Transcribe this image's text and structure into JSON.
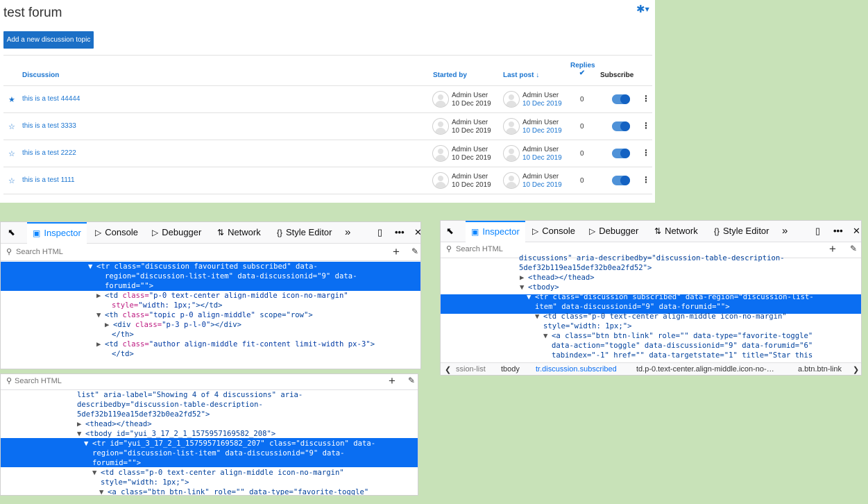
{
  "forum": {
    "title": "test forum",
    "add_button": "Add a new discussion topic",
    "headers": {
      "discussion": "Discussion",
      "started_by": "Started by",
      "last_post": "Last post",
      "replies": "Replies",
      "subscribe": "Subscribe"
    },
    "rows": [
      {
        "topic": "this is a test 44444",
        "starred": true,
        "start_user": "Admin User",
        "start_date": "10 Dec 2019",
        "last_user": "Admin User",
        "last_date": "10 Dec 2019",
        "replies": "0",
        "subscribed": true
      },
      {
        "topic": "this is a test 3333",
        "starred": false,
        "start_user": "Admin User",
        "start_date": "10 Dec 2019",
        "last_user": "Admin User",
        "last_date": "10 Dec 2019",
        "replies": "0",
        "subscribed": true
      },
      {
        "topic": "this is a test 2222",
        "starred": false,
        "start_user": "Admin User",
        "start_date": "10 Dec 2019",
        "last_user": "Admin User",
        "last_date": "10 Dec 2019",
        "replies": "0",
        "subscribed": true
      },
      {
        "topic": "this is a test 1111",
        "starred": false,
        "start_user": "Admin User",
        "start_date": "10 Dec 2019",
        "last_user": "Admin User",
        "last_date": "10 Dec 2019",
        "replies": "0",
        "subscribed": true
      }
    ]
  },
  "devtools": {
    "tabs": {
      "inspector": "Inspector",
      "console": "Console",
      "debugger": "Debugger",
      "network": "Network",
      "style_editor": "Style Editor"
    },
    "search_placeholder": "Search HTML"
  },
  "panel1": {
    "lines": [
      {
        "a": "<tr ",
        "b": "class=",
        "c": "\"discussion favourited subscribed\"",
        "d": " data-"
      },
      {
        "a": "",
        "b": "region=",
        "c": "\"discussion-list-item\"",
        "d": " data-discussionid=\"9\" data-"
      },
      {
        "a": "",
        "b": "forumid=",
        "c": "\"\"",
        "d": ">"
      },
      {
        "a": "<td ",
        "b": "class=",
        "c": "\"p-0 text-center align-middle icon-no-margin\"",
        "d": ""
      },
      {
        "a": "",
        "b": "style=",
        "c": "\"width: 1px;\"",
        "d": "></td>"
      },
      {
        "a": "<th ",
        "b": "class=",
        "c": "\"topic p-0 align-middle\"",
        "d": " scope=\"row\">"
      },
      {
        "a": "<div ",
        "b": "class=",
        "c": "\"p-3 p-l-0\"",
        "d": "></div>"
      },
      {
        "a": "</th>",
        "b": "",
        "c": "",
        "d": ""
      },
      {
        "a": "<td ",
        "b": "class=",
        "c": "\"author align-middle fit-content limit-width px-3\"",
        "d": ">"
      },
      {
        "a": "</td>",
        "b": "",
        "c": "",
        "d": ""
      }
    ]
  },
  "panel2": {
    "lines": [
      {
        "text": "list\" aria-label=\"Showing 4 of 4 discussions\" aria-"
      },
      {
        "text": "describedby=\"discussion-table-description-"
      },
      {
        "text": "5def32b119ea15def32b0ea2fd52\">"
      },
      {
        "text": "<thead></thead>"
      },
      {
        "text": "<tbody id=\"yui_3_17_2_1_1575957169582_208\">"
      },
      {
        "text": "<tr id=\"yui_3_17_2_1_1575957169582_207\" class=\"discussion\" data-"
      },
      {
        "text": "region=\"discussion-list-item\" data-discussionid=\"9\" data-"
      },
      {
        "text": "forumid=\"\">"
      },
      {
        "text": "<td class=\"p-0 text-center align-middle icon-no-margin\""
      },
      {
        "text": "style=\"width: 1px;\">"
      },
      {
        "text": "<a class=\"btn btn-link\" role=\"\" data-type=\"favorite-toggle\""
      }
    ]
  },
  "panel3": {
    "lines": [
      {
        "text": "discussions\" aria-describedby=\"discussion-table-description-"
      },
      {
        "text": "5def32b119ea15def32b0ea2fd52\">"
      },
      {
        "text": "<thead></thead>"
      },
      {
        "text": "<tbody>"
      },
      {
        "text": "<tr class=\"discussion subscribed\" data-region=\"discussion-list-"
      },
      {
        "text": "item\" data-discussionid=\"9\" data-forumid=\"\">"
      },
      {
        "text": "<td class=\"p-0 text-center align-middle icon-no-margin\""
      },
      {
        "text": "style=\"width: 1px;\">"
      },
      {
        "text": "<a class=\"btn btn-link\" role=\"\" data-type=\"favorite-toggle\""
      },
      {
        "text": "data-action=\"toggle\" data-discussionid=\"9\" data-forumid=\"6\""
      },
      {
        "text": "tabindex=\"-1\" href=\"\" data-targetstate=\"1\" title=\"Star this"
      }
    ],
    "breadcrumbs": [
      "ssion-list",
      "tbody",
      "tr.discussion.subscribed",
      "td.p-0.text-center.align-middle.icon-no-…",
      "a.btn.btn-link"
    ]
  }
}
